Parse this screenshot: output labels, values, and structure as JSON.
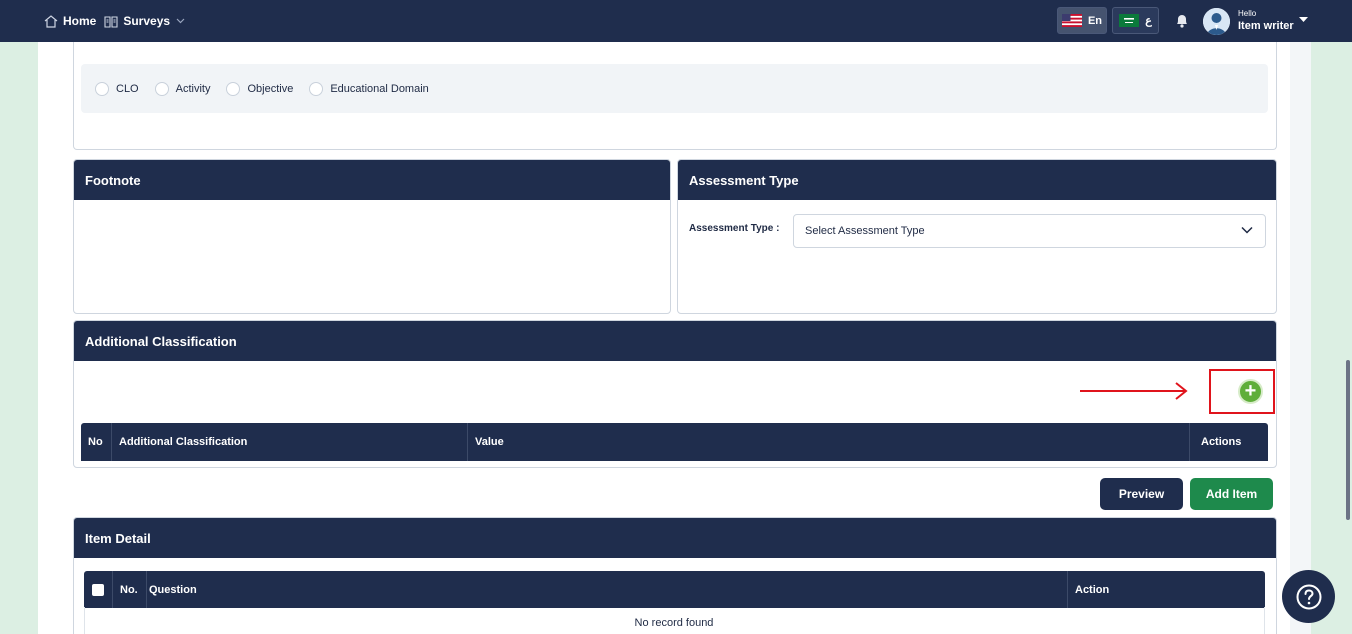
{
  "topbar": {
    "home_label": "Home",
    "surveys_label": "Surveys",
    "lang_en_label": "En",
    "lang_ar_label": "ع",
    "hello_label": "Hello",
    "user_name": "Item writer"
  },
  "options_panel": {
    "radios": [
      {
        "label": "CLO"
      },
      {
        "label": "Activity"
      },
      {
        "label": "Objective"
      },
      {
        "label": "Educational Domain"
      }
    ]
  },
  "footnote": {
    "title": "Footnote"
  },
  "assessment_type": {
    "title": "Assessment Type",
    "field_label": "Assessment Type :",
    "select_value": "Select Assessment Type"
  },
  "additional_classification": {
    "title": "Additional Classification",
    "add_button_symbol": "+",
    "columns": [
      "No",
      "Additional Classification",
      "Value",
      "Actions"
    ]
  },
  "actions": {
    "preview_label": "Preview",
    "add_item_label": "Add Item"
  },
  "item_detail": {
    "title": "Item Detail",
    "columns": [
      "No.",
      "Question",
      "Action"
    ],
    "empty_message": "No record found"
  },
  "help": {
    "symbol": "?"
  },
  "colors": {
    "navy": "#1f2d4d",
    "green": "#1e8a4c",
    "plus_green": "#5fae3a",
    "highlight_red": "#e0141c"
  }
}
